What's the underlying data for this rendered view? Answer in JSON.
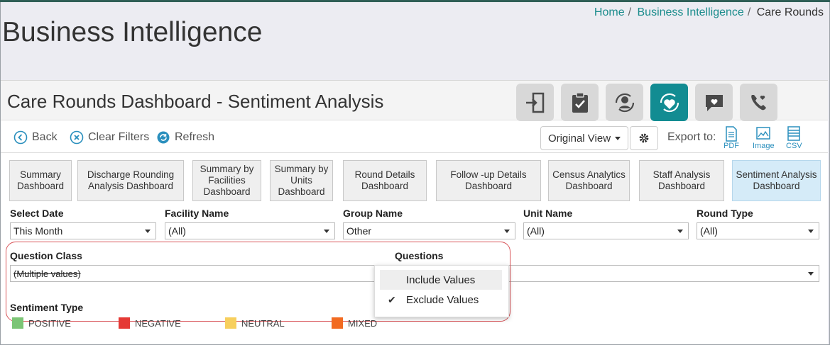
{
  "breadcrumb": {
    "home": "Home",
    "sep": "/",
    "bi": "Business Intelligence",
    "current": "Care Rounds"
  },
  "page_title": "Business Intelligence",
  "dashboard_title": "Care Rounds Dashboard - Sentiment Analysis",
  "nav_icons": [
    "exit-door-icon",
    "clipboard-check-icon",
    "user-rotate-icon",
    "heart-refresh-icon",
    "chat-heart-icon",
    "phone-heart-icon"
  ],
  "toolbar": {
    "back": "Back",
    "clear_filters": "Clear Filters",
    "refresh": "Refresh",
    "view": "Original View",
    "export_label": "Export to:",
    "pdf": "PDF",
    "image": "Image",
    "csv": "CSV"
  },
  "tabs": [
    "Summary Dashboard",
    "Discharge Rounding Analysis Dashboard",
    "Summary by Facilities Dashboard",
    "Summary by Units Dashboard",
    "Round Details Dashboard",
    "Follow -up Details Dashboard",
    "Census Analytics Dashboard",
    "Staff Analysis Dashboard",
    "Sentiment Analysis Dashboard"
  ],
  "filters": {
    "select_date": {
      "label": "Select Date",
      "value": "This Month"
    },
    "facility": {
      "label": "Facility Name",
      "value": "(All)"
    },
    "group": {
      "label": "Group Name",
      "value": "Other"
    },
    "unit": {
      "label": "Unit Name",
      "value": "(All)"
    },
    "round_type": {
      "label": "Round Type",
      "value": "(All)"
    },
    "question_class": {
      "label": "Question Class",
      "value": "(Multiple values)"
    },
    "questions": {
      "label": "Questions"
    }
  },
  "questions_menu": [
    "Include Values",
    "Exclude Values"
  ],
  "questions_menu_checked": "Exclude Values",
  "sentiment": {
    "label": "Sentiment Type",
    "items": [
      {
        "name": "POSITIVE",
        "color": "#7cc576"
      },
      {
        "name": "NEGATIVE",
        "color": "#e53935"
      },
      {
        "name": "NEUTRAL",
        "color": "#f7cf5d"
      },
      {
        "name": "MIXED",
        "color": "#f26b21"
      }
    ]
  },
  "colors": {
    "accent": "#128c92",
    "link": "#1a8c8c",
    "highlight_border": "#d9565a"
  }
}
